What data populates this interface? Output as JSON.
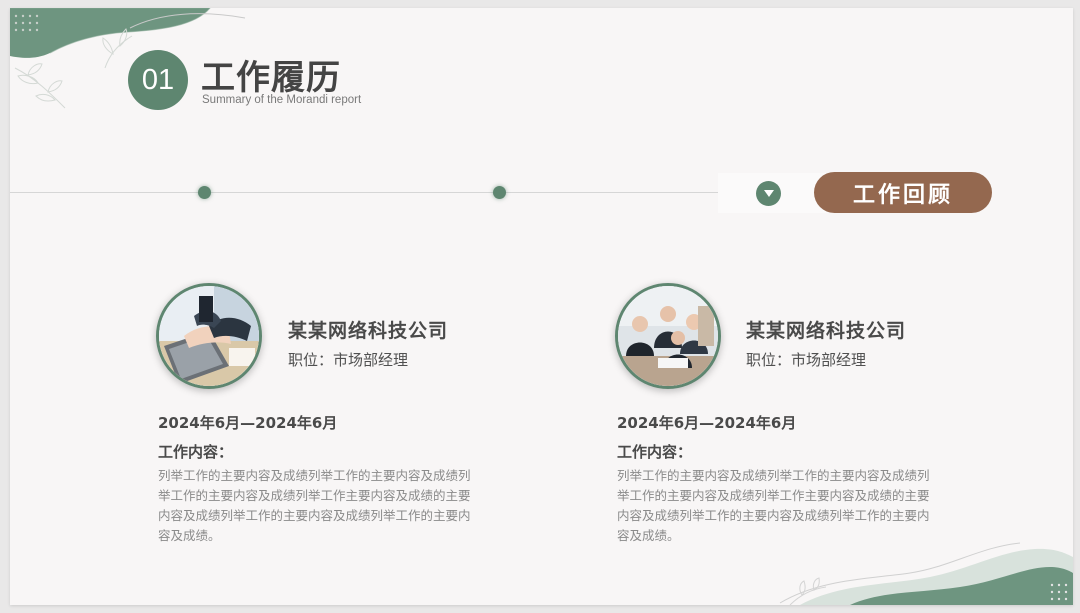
{
  "header": {
    "number": "01",
    "title": "工作履历",
    "subtitle": "Summary of the Morandi report"
  },
  "tab": {
    "label": "工作回顾"
  },
  "colors": {
    "accent_green": "#5e8670",
    "accent_brown": "#94684f",
    "background": "#f8f6f6"
  },
  "entries": [
    {
      "company": "某某网络科技公司",
      "position": "职位：市场部经理",
      "date": "2024年6月—2024年6月",
      "content_label": "工作内容：",
      "description": "列举工作的主要内容及成绩列举工作的主要内容及成绩列举工作的主要内容及成绩列举工作主要内容及成绩的主要内容及成绩列举工作的主要内容及成绩列举工作的主要内容及成绩。"
    },
    {
      "company": "某某网络科技公司",
      "position": "职位：市场部经理",
      "date": "2024年6月—2024年6月",
      "content_label": "工作内容：",
      "description": "列举工作的主要内容及成绩列举工作的主要内容及成绩列举工作的主要内容及成绩列举工作主要内容及成绩的主要内容及成绩列举工作的主要内容及成绩列举工作的主要内容及成绩。"
    }
  ]
}
